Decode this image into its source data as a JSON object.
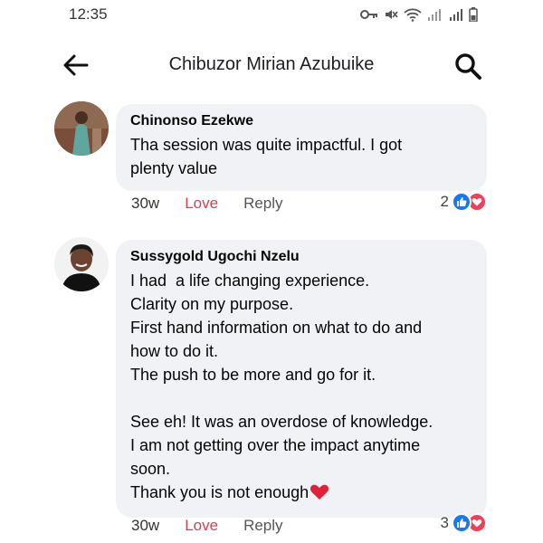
{
  "status_bar": {
    "time": "12:35"
  },
  "header": {
    "title": "Chibuzor Mirian Azubuike",
    "back_icon": "arrow-left-icon",
    "search_icon": "search-icon"
  },
  "comments": [
    {
      "author": "Chinonso Ezekwe",
      "lines": [
        "Tha session was quite impactful. I got",
        "plenty value"
      ],
      "time": "30w",
      "love_label": "Love",
      "reply_label": "Reply",
      "reaction_count": "2"
    },
    {
      "author": "Sussygold Ugochi Nzelu",
      "lines": [
        "I had  a life changing experience.",
        "Clarity on my purpose.",
        "First hand information on what to do and",
        "how to do it.",
        "The push to be more and go for it.",
        "",
        "See eh! It was an overdose of knowledge.",
        "I am not getting over the impact anytime",
        "soon.",
        "Thank you is not enough"
      ],
      "time": "30w",
      "love_label": "Love",
      "reply_label": "Reply",
      "reaction_count": "3"
    }
  ],
  "colors": {
    "like_blue": "#1877f2",
    "love_red": "#f33e58",
    "bubble_bg": "#f0f2f5",
    "love_label": "#d93d4f"
  }
}
